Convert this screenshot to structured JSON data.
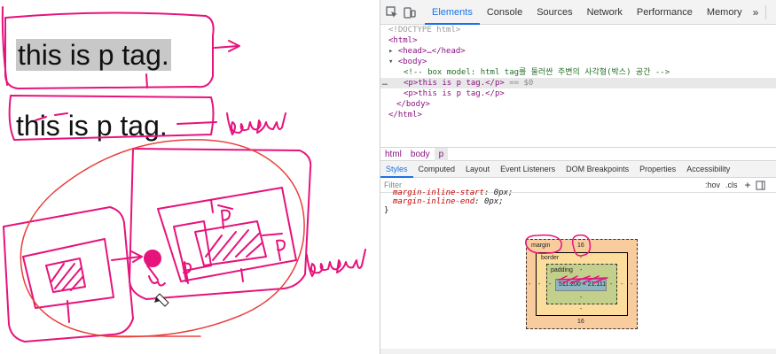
{
  "page": {
    "paragraph_1": "this is p tag.",
    "paragraph_2": "this is p tag.",
    "annotation_1": "border",
    "annotation_2": "border",
    "annotation_p": "P"
  },
  "devtools": {
    "tabs": [
      "Elements",
      "Console",
      "Sources",
      "Network",
      "Performance",
      "Memory"
    ],
    "active_tab": "Elements",
    "more_tabs": "»",
    "dom": {
      "doctype": "<!DOCTYPE html>",
      "html_open": "<html>",
      "head": "<head>…</head>",
      "body_open": "<body>",
      "comment": "<!-- box model: html tag를 둘러싼 주변의 사각형(박스) 공간 -->",
      "p_selected": "<p>this is p tag.</p>",
      "p_selected_marker": "== $0",
      "p_second": "<p>this is p tag.</p>",
      "body_close": "</body>",
      "html_close": "</html>",
      "ellipsis": "…"
    },
    "breadcrumbs": [
      "html",
      "body",
      "p"
    ],
    "subtabs": [
      "Styles",
      "Computed",
      "Layout",
      "Event Listeners",
      "DOM Breakpoints",
      "Properties",
      "Accessibility"
    ],
    "active_subtab": "Styles",
    "filter_placeholder": "Filter",
    "filter_tools": {
      "hov": ":hov",
      "cls": ".cls",
      "plus": "+"
    },
    "rules": [
      {
        "prop": "margin-inline-start",
        "value": "0px;"
      },
      {
        "prop": "margin-inline-end",
        "value": "0px;"
      }
    ],
    "rule_close": "}",
    "box_model": {
      "margin_label": "margin",
      "margin_top": "16",
      "margin_bottom": "16",
      "margin_left": "-",
      "margin_right": "-",
      "border_label": "border",
      "border_top": "-",
      "border_bottom": "-",
      "border_left": "-",
      "border_right": "-",
      "padding_label": "padding",
      "padding_top": "-",
      "padding_bottom": "-",
      "padding_left": "-",
      "padding_right": "-",
      "content": "511.200 × 21.111"
    }
  },
  "colors": {
    "annotation_ink": "#e6137c",
    "red_ink": "#e8403c",
    "selection_bg": "#c8c8c8",
    "active_tab": "#1a73e8"
  }
}
